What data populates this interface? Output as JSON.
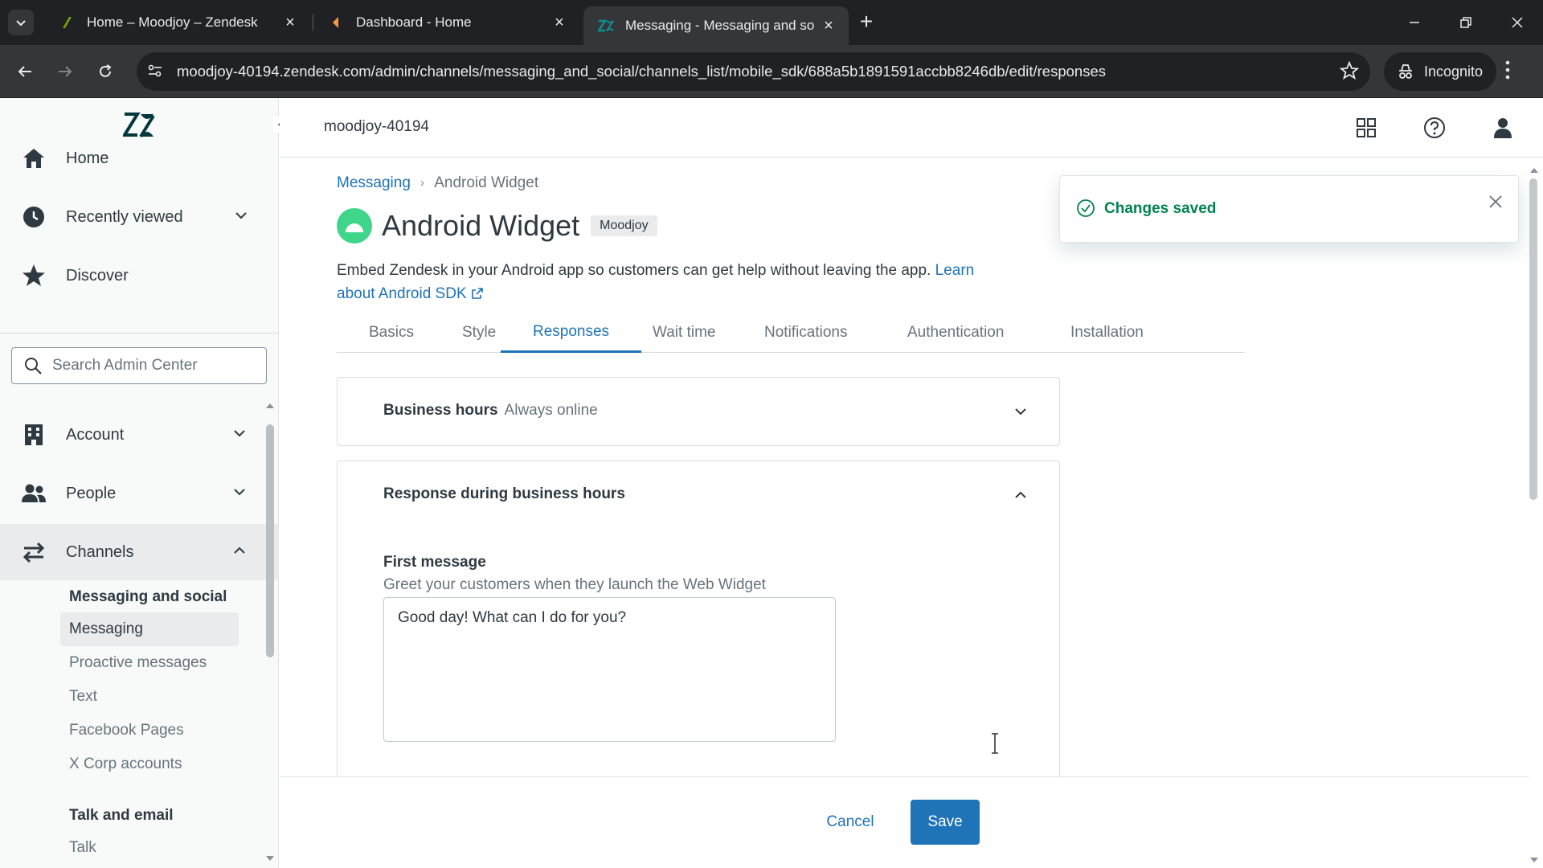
{
  "browser": {
    "tabs": [
      {
        "title": "Home – Moodjoy – Zendesk",
        "favicon_color": "#78a300"
      },
      {
        "title": "Dashboard - Home",
        "favicon_color": "#f79a3e"
      },
      {
        "title": "Messaging - Messaging and so",
        "favicon_color": "#03363d"
      }
    ],
    "url": "moodjoy-40194.zendesk.com/admin/channels/messaging_and_social/channels_list/mobile_sdk/688a5b1891591accbb8246db/edit/responses",
    "incognito_label": "Incognito"
  },
  "sidebar": {
    "nav": [
      {
        "label": "Home",
        "icon": "home-icon"
      },
      {
        "label": "Recently viewed",
        "icon": "clock-icon"
      },
      {
        "label": "Discover",
        "icon": "star-icon"
      }
    ],
    "search_placeholder": "Search Admin Center",
    "sections": [
      {
        "label": "Account",
        "icon": "building-icon"
      },
      {
        "label": "People",
        "icon": "people-icon"
      },
      {
        "label": "Channels",
        "icon": "channels-icon"
      }
    ],
    "channels_group_1": "Messaging and social",
    "channels_items": [
      "Messaging",
      "Proactive messages",
      "Text",
      "Facebook Pages",
      "X Corp accounts"
    ],
    "channels_group_2": "Talk and email",
    "channels_items_2": [
      "Talk"
    ]
  },
  "header": {
    "subdomain": "moodjoy-40194"
  },
  "breadcrumb": {
    "parent": "Messaging",
    "current": "Android Widget"
  },
  "page": {
    "title": "Android Widget",
    "brand": "Moodjoy",
    "description": "Embed Zendesk in your Android app so customers can get help without leaving the app.",
    "learn_more": "Learn about Android SDK"
  },
  "tabs": [
    "Basics",
    "Style",
    "Responses",
    "Wait time",
    "Notifications",
    "Authentication",
    "Installation"
  ],
  "active_tab": "Responses",
  "business_hours": {
    "label": "Business hours",
    "value": "Always online"
  },
  "response_section": {
    "title": "Response during business hours",
    "first_message_label": "First message",
    "first_message_hint": "Greet your customers when they launch the Web Widget",
    "first_message_value": "Good day! What can I do for you?"
  },
  "footer": {
    "cancel": "Cancel",
    "save": "Save"
  },
  "toast": {
    "message": "Changes saved"
  },
  "colors": {
    "accent": "#1f73b7",
    "success": "#038153",
    "widget": "#3fd68b"
  }
}
